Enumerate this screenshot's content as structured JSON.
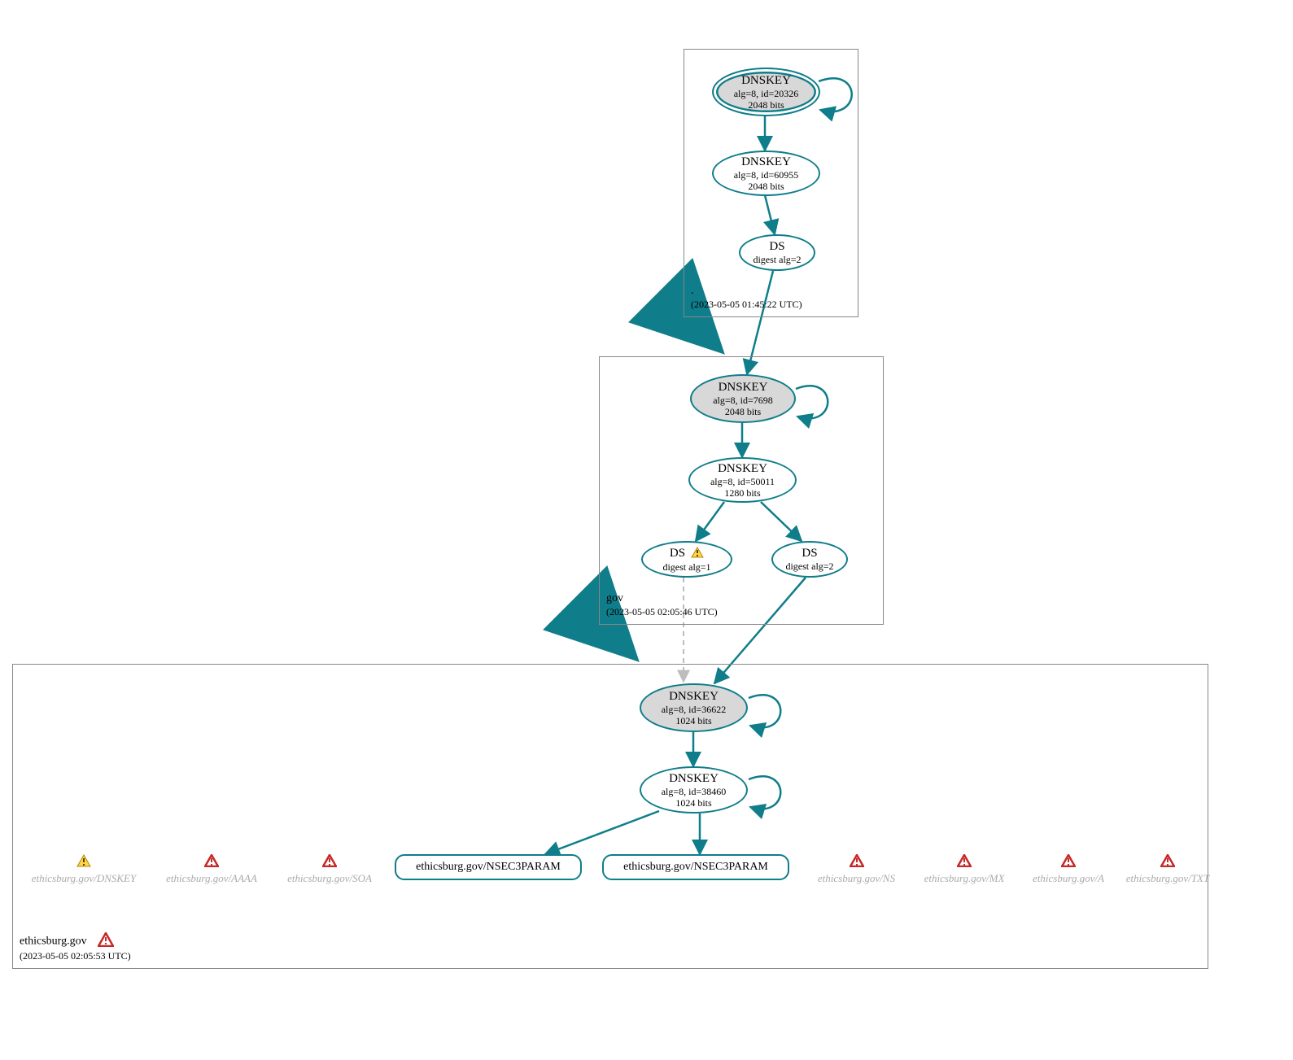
{
  "zones": {
    "root": {
      "name": ".",
      "timestamp": "(2023-05-05 01:45:22 UTC)"
    },
    "gov": {
      "name": "gov",
      "timestamp": "(2023-05-05 02:05:46 UTC)"
    },
    "leaf": {
      "name": "ethicsburg.gov",
      "timestamp": "(2023-05-05 02:05:53 UTC)",
      "has_error": true
    }
  },
  "nodes": {
    "root_ksk": {
      "title": "DNSKEY",
      "detail": "alg=8, id=20326",
      "bits": "2048 bits"
    },
    "root_zsk": {
      "title": "DNSKEY",
      "detail": "alg=8, id=60955",
      "bits": "2048 bits"
    },
    "root_ds": {
      "title": "DS",
      "detail": "digest alg=2"
    },
    "gov_ksk": {
      "title": "DNSKEY",
      "detail": "alg=8, id=7698",
      "bits": "2048 bits"
    },
    "gov_zsk": {
      "title": "DNSKEY",
      "detail": "alg=8, id=50011",
      "bits": "1280 bits"
    },
    "gov_ds1": {
      "title": "DS",
      "detail": "digest alg=1",
      "warn": true
    },
    "gov_ds2": {
      "title": "DS",
      "detail": "digest alg=2"
    },
    "leaf_ksk": {
      "title": "DNSKEY",
      "detail": "alg=8, id=36622",
      "bits": "1024 bits"
    },
    "leaf_zsk": {
      "title": "DNSKEY",
      "detail": "alg=8, id=38460",
      "bits": "1024 bits"
    }
  },
  "rrsets": {
    "nsec3a": "ethicsburg.gov/NSEC3PARAM",
    "nsec3b": "ethicsburg.gov/NSEC3PARAM"
  },
  "bad_rrsets": [
    {
      "label": "ethicsburg.gov/DNSKEY",
      "severity": "warn"
    },
    {
      "label": "ethicsburg.gov/AAAA",
      "severity": "error"
    },
    {
      "label": "ethicsburg.gov/SOA",
      "severity": "error"
    },
    {
      "label": "ethicsburg.gov/NS",
      "severity": "error"
    },
    {
      "label": "ethicsburg.gov/MX",
      "severity": "error"
    },
    {
      "label": "ethicsburg.gov/A",
      "severity": "error"
    },
    {
      "label": "ethicsburg.gov/TXT",
      "severity": "error"
    }
  ],
  "colors": {
    "stroke": "#0f7d8a",
    "dashed": "#bdbdbd"
  }
}
